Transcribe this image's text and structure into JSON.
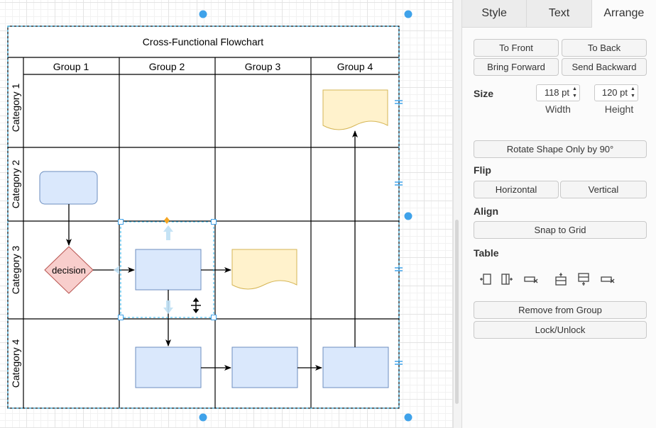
{
  "diagram": {
    "title": "Cross-Functional Flowchart",
    "columns": [
      "Group 1",
      "Group 2",
      "Group 3",
      "Group 4"
    ],
    "rows": [
      "Category 1",
      "Category 2",
      "Category 3",
      "Category 4"
    ],
    "decision_label": "decision",
    "colors": {
      "process_fill": "#dae8fc",
      "process_stroke": "#6c8ebf",
      "document_fill": "#fff2cc",
      "document_stroke": "#d6b656",
      "decision_fill": "#f8cecc",
      "decision_stroke": "#b85450",
      "selection": "#29b6f2",
      "handle": "#3fa2ea"
    }
  },
  "panel": {
    "tabs": [
      {
        "label": "Style",
        "active": false
      },
      {
        "label": "Text",
        "active": false
      },
      {
        "label": "Arrange",
        "active": true
      }
    ],
    "order_buttons": {
      "to_front": "To Front",
      "to_back": "To Back",
      "bring_forward": "Bring Forward",
      "send_backward": "Send Backward"
    },
    "size": {
      "label": "Size",
      "width_value": "118 pt",
      "height_value": "120 pt",
      "width_label": "Width",
      "height_label": "Height"
    },
    "rotate_button": "Rotate Shape Only by 90°",
    "flip": {
      "label": "Flip",
      "horizontal": "Horizontal",
      "vertical": "Vertical"
    },
    "align": {
      "label": "Align",
      "snap_to_grid": "Snap to Grid"
    },
    "table": {
      "label": "Table",
      "icons": [
        "insert-column-before-icon",
        "insert-column-after-icon",
        "delete-column-icon",
        "insert-row-before-icon",
        "insert-row-after-icon",
        "delete-row-icon"
      ]
    },
    "remove_from_group": "Remove from Group",
    "lock_unlock": "Lock/Unlock"
  }
}
